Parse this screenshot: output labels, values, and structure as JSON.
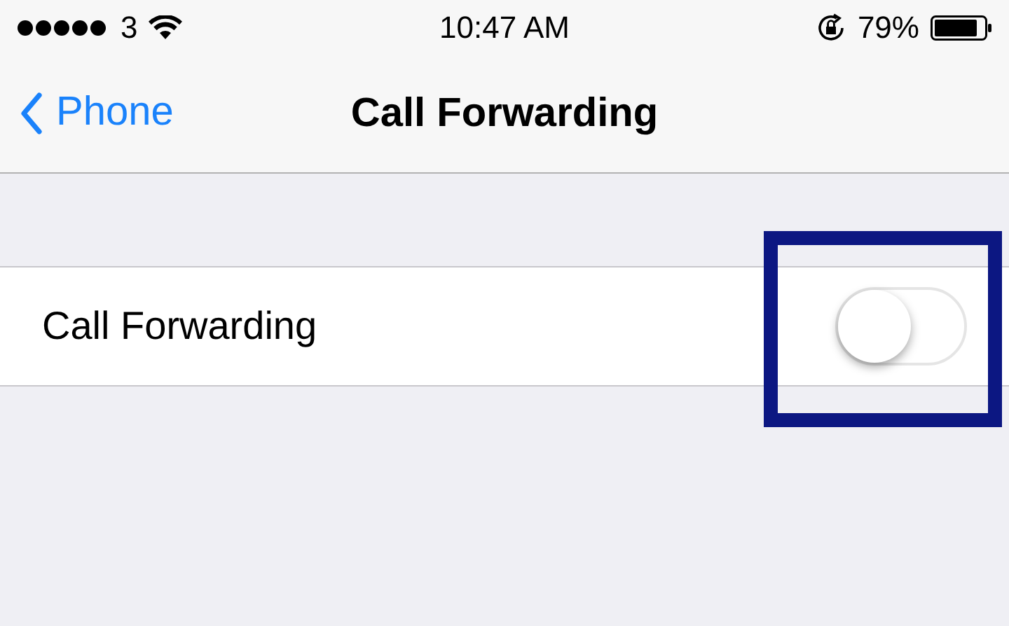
{
  "status_bar": {
    "carrier": "3",
    "time": "10:47 AM",
    "battery_percent": "79%"
  },
  "nav_bar": {
    "back_label": "Phone",
    "title": "Call Forwarding"
  },
  "settings": [
    {
      "label": "Call Forwarding",
      "kind": "toggle",
      "on": false
    }
  ],
  "overlay": {
    "kind": "highlight-frame"
  }
}
